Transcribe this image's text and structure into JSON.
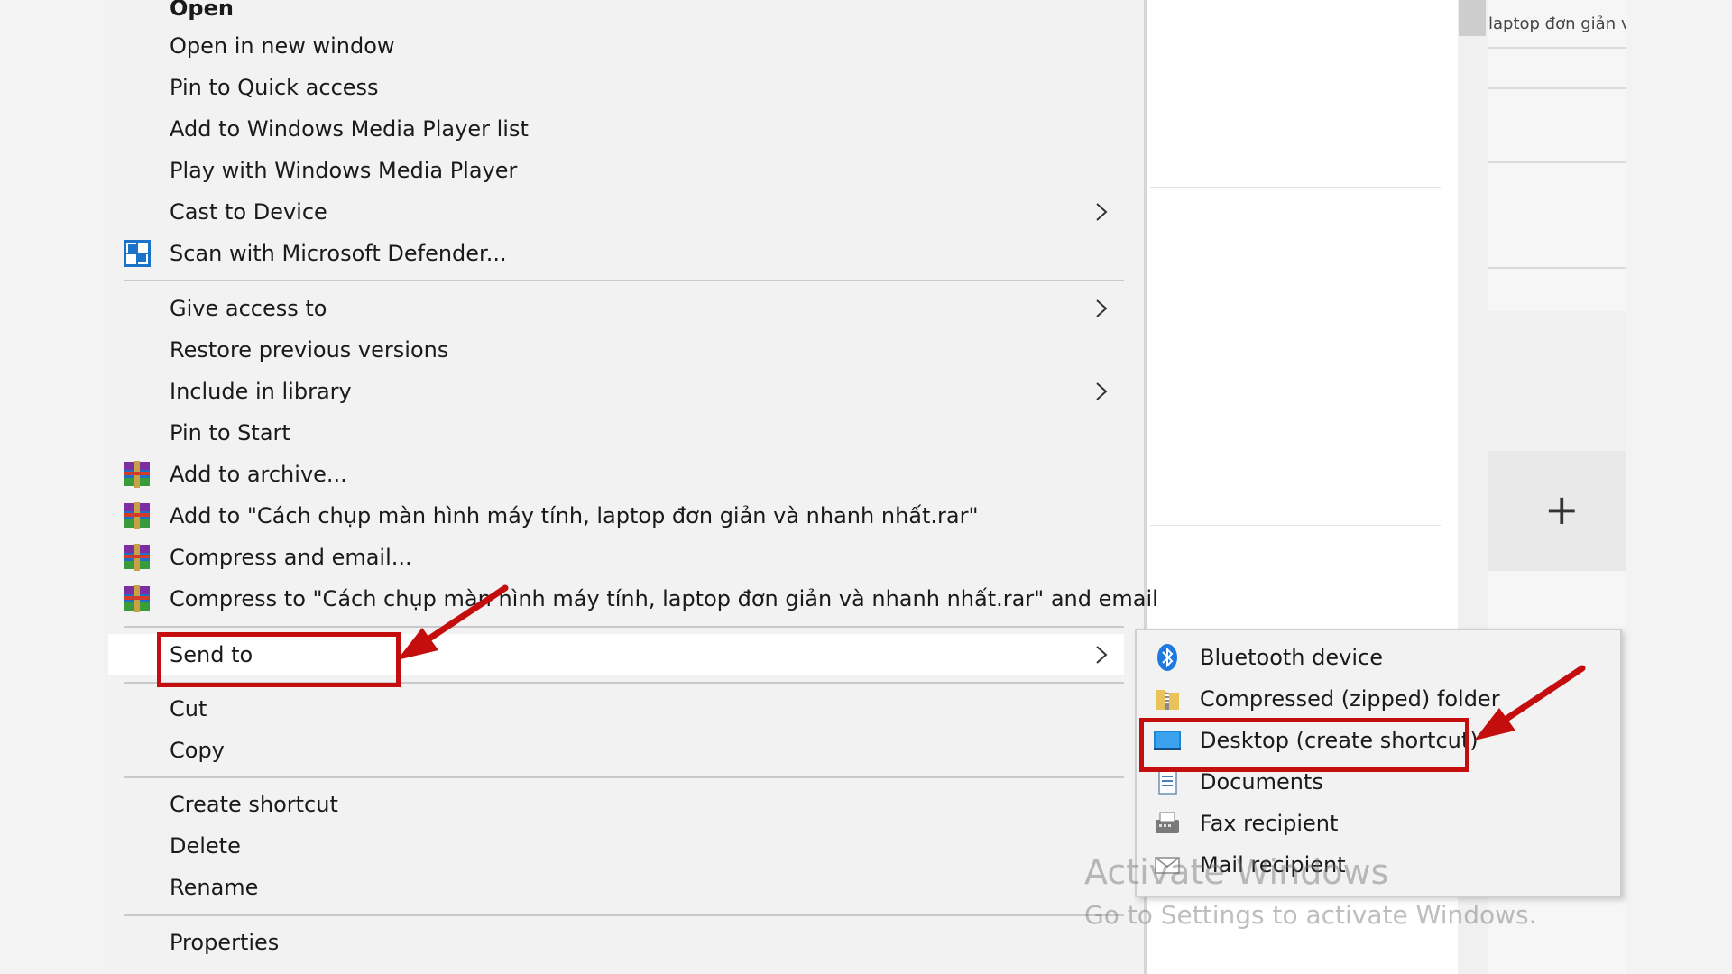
{
  "context_menu": {
    "items": [
      {
        "label": "Open",
        "bold": true
      },
      {
        "label": "Open in new window"
      },
      {
        "label": "Pin to Quick access"
      },
      {
        "label": "Add to Windows Media Player list"
      },
      {
        "label": "Play with Windows Media Player"
      },
      {
        "label": "Cast to Device",
        "submenu": true
      },
      {
        "label": "Scan with Microsoft Defender...",
        "icon": "defender-shield-icon"
      },
      {
        "label": "Give access to",
        "submenu": true
      },
      {
        "label": "Restore previous versions"
      },
      {
        "label": "Include in library",
        "submenu": true
      },
      {
        "label": "Pin to Start"
      },
      {
        "label": "Add to archive...",
        "icon": "winrar-icon"
      },
      {
        "label": "Add to \"Cách chụp màn hình máy tính, laptop đơn giản và nhanh nhất.rar\"",
        "icon": "winrar-icon"
      },
      {
        "label": "Compress and email...",
        "icon": "winrar-icon"
      },
      {
        "label": "Compress to \"Cách chụp màn hình máy tính, laptop đơn giản và nhanh nhất.rar\" and email",
        "icon": "winrar-icon"
      },
      {
        "label": "Send to",
        "submenu": true,
        "highlighted": true
      },
      {
        "label": "Cut"
      },
      {
        "label": "Copy"
      },
      {
        "label": "Create shortcut"
      },
      {
        "label": "Delete"
      },
      {
        "label": "Rename"
      },
      {
        "label": "Properties"
      }
    ]
  },
  "send_to_submenu": {
    "items": [
      {
        "label": "Bluetooth device",
        "icon": "bluetooth-icon"
      },
      {
        "label": "Compressed (zipped) folder",
        "icon": "zip-folder-icon"
      },
      {
        "label": "Desktop (create shortcut)",
        "icon": "desktop-icon",
        "annotated": true
      },
      {
        "label": "Documents",
        "icon": "documents-icon"
      },
      {
        "label": "Fax recipient",
        "icon": "fax-icon"
      },
      {
        "label": "Mail recipient",
        "icon": "mail-icon"
      }
    ]
  },
  "background": {
    "snippet": "laptop đơn giản và",
    "plus": "+"
  },
  "watermark": {
    "title": "Activate Windows",
    "subtitle": "Go to Settings to activate Windows."
  },
  "colors": {
    "annotation_red": "#c40d0d",
    "menu_bg": "#f2f2f2",
    "highlight_bg": "#ffffff",
    "accent_blue": "#0078d7"
  }
}
